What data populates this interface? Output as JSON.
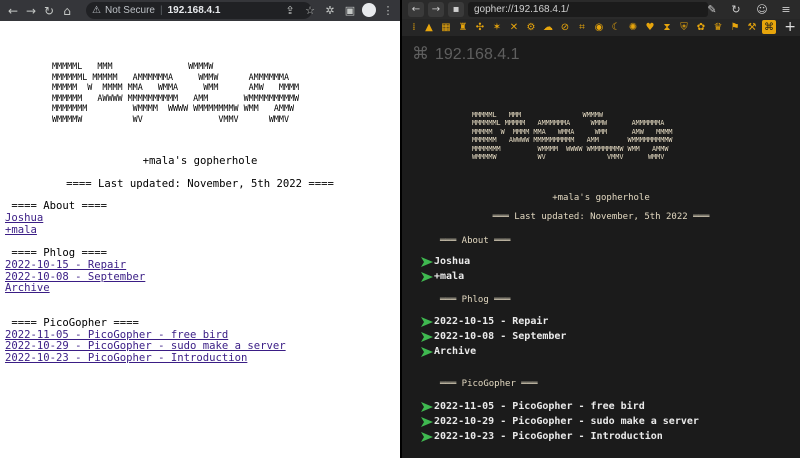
{
  "chrome": {
    "security_label": "Not Secure",
    "url": "192.168.4.1"
  },
  "left_page": {
    "ascii_art": "MMMMML   MMM               WMMMW\nMMMMMML MMMMM   AMMMMMMA     WMMW      AMMMMMMA\nMMMMM  W  MMMM MMA   WMMA     WMM      AMW   MMMM\nMMMMMM   AWWWW MMMMMMMMMM   AMM       WMMMMMMMMMW\nMMMMMMM         WMMMM  WWWW WMMMMMMMW WMM   AMMW\nWMMMMW          WV               VMMV      WMMV",
    "gopherhole": "+mala's gopherhole",
    "updated": "==== Last updated: November, 5th 2022 ====",
    "about_head": " ==== About ====",
    "about_links": [
      "Joshua",
      "+mala"
    ],
    "phlog_head": " ==== Phlog ====",
    "phlog_links": [
      "2022-10-15 - Repair",
      "2022-10-08 - September",
      "Archive"
    ],
    "pico_head": " ==== PicoGopher ====",
    "pico_links": [
      "2022-11-05 - PicoGopher - free bird",
      "2022-10-29 - PicoGopher - sudo make a server",
      "2022-10-23 - PicoGopher - Introduction"
    ]
  },
  "gopher": {
    "url": "gopher://192.168.4.1/",
    "title": "192.168.4.1",
    "ascii_art": "MMMMML   MMM               WMMMW\nMMMMMML MMMMM   AMMMMMMA     WMMW      AMMMMMMA\nMMMMM  W  MMMM MMA   WMMA     WMM      AMW   MMMM\nMMMMMM   AWWWW MMMMMMMMMM   AMM       WMMMMMMMMMW\nMMMMMMM         WMMMM  WWWW WMMMMMMMW WMM   AMMW\nWMMMMW          WV               VMMV      WMMV",
    "gopherhole": "+mala's gopherhole",
    "updated": "═══ Last updated: November, 5th 2022 ═══",
    "about_head": "═══ About ═══",
    "about_links": [
      "Joshua",
      "+mala"
    ],
    "phlog_head": "═══ Phlog ═══",
    "phlog_links": [
      "2022-10-15 - Repair",
      "2022-10-08 - September",
      "Archive"
    ],
    "pico_head": "═══ PicoGopher ═══",
    "pico_links": [
      "2022-11-05 - PicoGopher - free bird",
      "2022-10-29 - PicoGopher - sudo make a server",
      "2022-10-23 - PicoGopher - Introduction"
    ]
  },
  "icons": {
    "chrome_nav": [
      "back-icon",
      "forward-icon",
      "reload-icon",
      "home-icon"
    ],
    "bookmarks": [
      "warning-icon",
      "map-icon",
      "castle-icon",
      "puzzle-icon",
      "star-icon",
      "cross-icon",
      "cloud-icon",
      "cancel-icon",
      "hash-icon",
      "sun-icon",
      "moon-icon",
      "trophy-icon",
      "flag-icon",
      "command-icon"
    ]
  },
  "colors": {
    "link": "#3a1d85",
    "gopher_bg": "#1b1b1b",
    "gopher_text": "#e2d8c0",
    "gopher_arrow": "#3fb950",
    "accent": "#e7a50c"
  }
}
